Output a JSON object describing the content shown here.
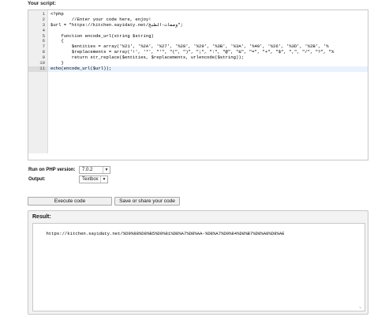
{
  "script_label": "Your script:",
  "editor": {
    "line_numbers": [
      "1",
      "2",
      "3",
      "4",
      "5",
      "6",
      "7",
      "8",
      "9",
      "10",
      "11"
    ],
    "active_line": 11,
    "lines": [
      "<?php",
      "        //Enter your code here, enjoy!",
      "$url = \"https://kitchen.sayidaty.net/وصفات-الطبخ\";",
      "",
      "    function encode_url(string $string)",
      "    {",
      "        $entities = array('%21', '%2A', '%27', '%28', '%29', '%3B', '%3A', '%40', '%26', '%3D', '%2B', '%",
      "        $replacements = array('!', '*', \"'\", \"(\", \")\", \";\", \":\", \"@\", \"&\", \"=\", \"+\", \"$\", \",\", \"/\", \"?\", \"%",
      "        return str_replace($entities, $replacements, urlencode($string));",
      "    }",
      "echo(encode_url($url));"
    ]
  },
  "scroll": {
    "left_arrow": "<",
    "right_arrow": ">"
  },
  "options": {
    "php_version_label": "Run on PHP version:",
    "php_version_value": "7.0.2",
    "output_label": "Output:",
    "output_value": "Textbox"
  },
  "buttons": {
    "execute": "Execute code",
    "save_share": "Save or share your code"
  },
  "result": {
    "label": "Result:",
    "text": "https://kitchen.sayidaty.net/%D9%88%D8%B5%D9%81%D8%A7%D8%AA-%D8%A7%D9%84%D8%B7%D8%A8%D8%AE"
  }
}
